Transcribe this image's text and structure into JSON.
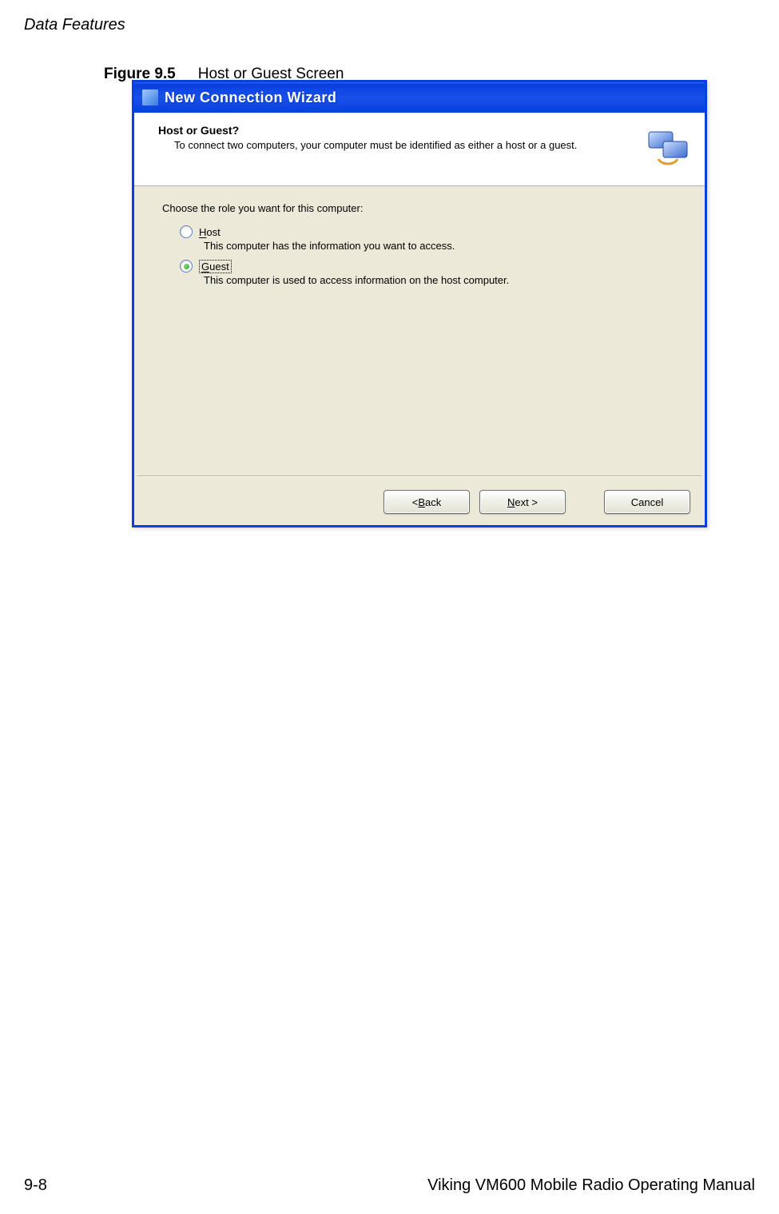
{
  "page": {
    "section_header": "Data Features",
    "figure_label": "Figure 9.5",
    "figure_title": "Host or Guest Screen",
    "footer_left": "9-8",
    "footer_right": "Viking VM600 Mobile Radio Operating Manual"
  },
  "wizard": {
    "titlebar": "New Connection Wizard",
    "header_title": "Host or Guest?",
    "header_desc": "To connect two computers, your computer must be identified as either a host or a guest.",
    "prompt": "Choose the role you want for this computer:",
    "options": [
      {
        "label_pre": "",
        "label_underlined": "H",
        "label_post": "ost",
        "desc": "This computer has the information you want to access.",
        "checked": false,
        "focused": false
      },
      {
        "label_pre": "",
        "label_underlined": "G",
        "label_post": "uest",
        "desc": "This computer is used to access information on the host computer.",
        "checked": true,
        "focused": true
      }
    ],
    "buttons": {
      "back_pre": "< ",
      "back_ul": "B",
      "back_post": "ack",
      "next_ul": "N",
      "next_post": "ext >",
      "cancel": "Cancel"
    }
  }
}
